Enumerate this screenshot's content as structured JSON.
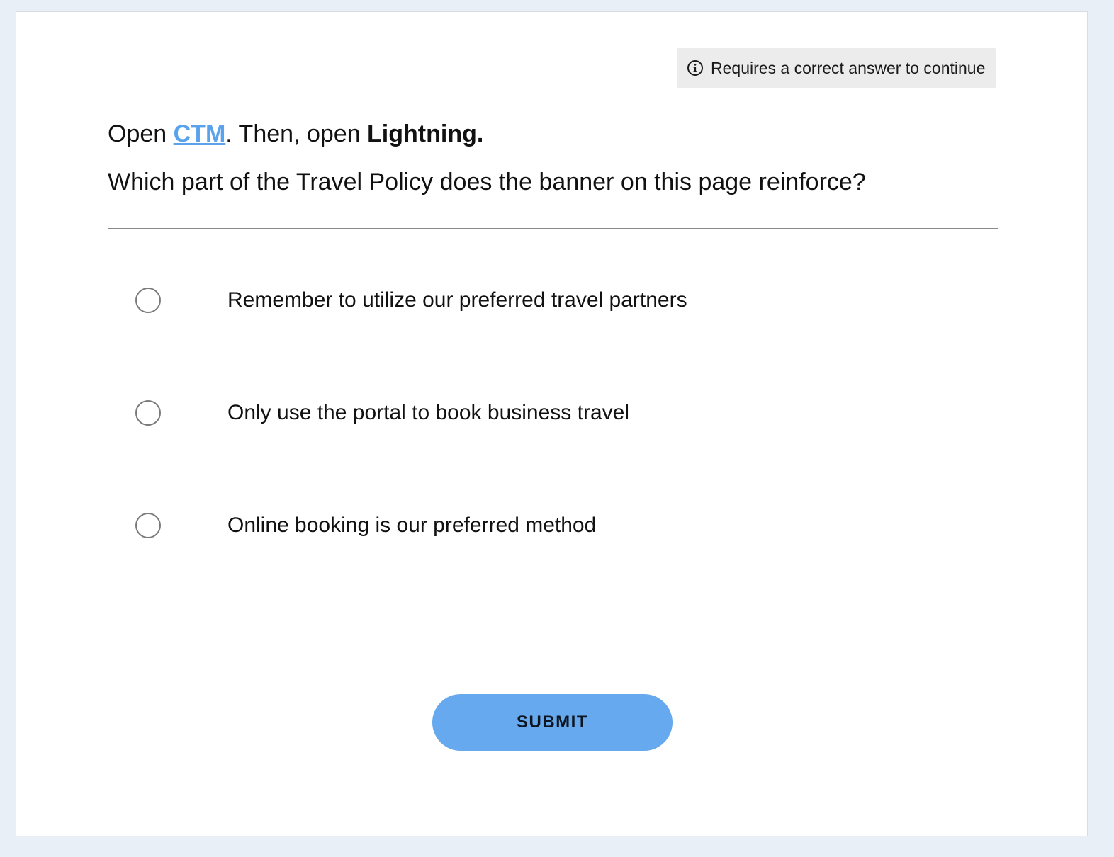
{
  "badge": {
    "icon": "info-circle-icon",
    "text": "Requires a correct answer to continue"
  },
  "instruction": {
    "prefix": "Open ",
    "link_text": "CTM",
    "middle": ". Then, open ",
    "bold_text": "Lightning."
  },
  "question": "Which part of the Travel Policy does the banner on this page reinforce?",
  "options": [
    {
      "label": "Remember to utilize our preferred travel partners",
      "selected": false
    },
    {
      "label": "Only use the portal to book business travel",
      "selected": false
    },
    {
      "label": "Online booking is our preferred method",
      "selected": false
    }
  ],
  "submit_label": "SUBMIT",
  "colors": {
    "link": "#5aa2ec",
    "submit_bg": "#66a9ee",
    "badge_bg": "#ececec",
    "page_bg": "#e9eff7"
  }
}
